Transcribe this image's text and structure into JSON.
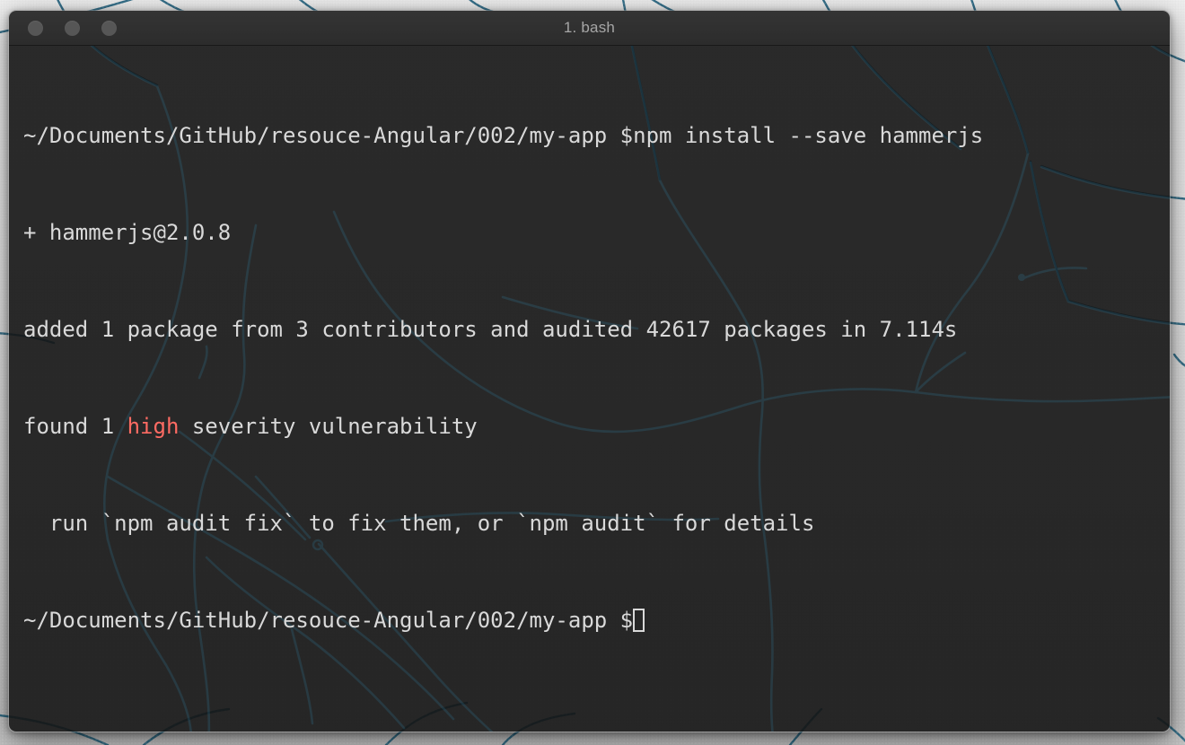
{
  "desktop": {
    "background_kind": "map-wallpaper",
    "road_color": "#2c6a86",
    "map_bg_top": "#efefef",
    "map_bg_bottom": "#c6c6c6"
  },
  "window": {
    "title": "1. bash",
    "app": "Terminal",
    "titlebar_color": "#2e2e2e",
    "body_color": "#1a1a1a",
    "traffic_lights": [
      {
        "name": "close",
        "color": "#565656"
      },
      {
        "name": "minimize",
        "color": "#565656"
      },
      {
        "name": "zoom",
        "color": "#565656"
      }
    ]
  },
  "terminal": {
    "text_color": "#d9d9d9",
    "highlight_color": "#ff6b63",
    "prompt_symbol": "$",
    "cwd": "~/Documents/GitHub/resouce-Angular/002/my-app",
    "lines": [
      {
        "id": "line-1-command",
        "text": "~/Documents/GitHub/resouce-Angular/002/my-app $npm install --save hammerjs"
      },
      {
        "id": "line-2-added-package",
        "text": "+ hammerjs@2.0.8"
      },
      {
        "id": "line-3-audit-summary",
        "text": "added 1 package from 3 contributors and audited 42617 packages in 7.114s"
      },
      {
        "id": "line-4-vulnerability-pre",
        "text": "found 1 "
      },
      {
        "id": "line-4-vulnerability-level",
        "text": "high"
      },
      {
        "id": "line-4-vulnerability-post",
        "text": " severity vulnerability"
      },
      {
        "id": "line-5-audit-hint",
        "text": "  run `npm audit fix` to fix them, or `npm audit` for details"
      },
      {
        "id": "line-6-prompt",
        "text": "~/Documents/GitHub/resouce-Angular/002/my-app $"
      }
    ]
  }
}
